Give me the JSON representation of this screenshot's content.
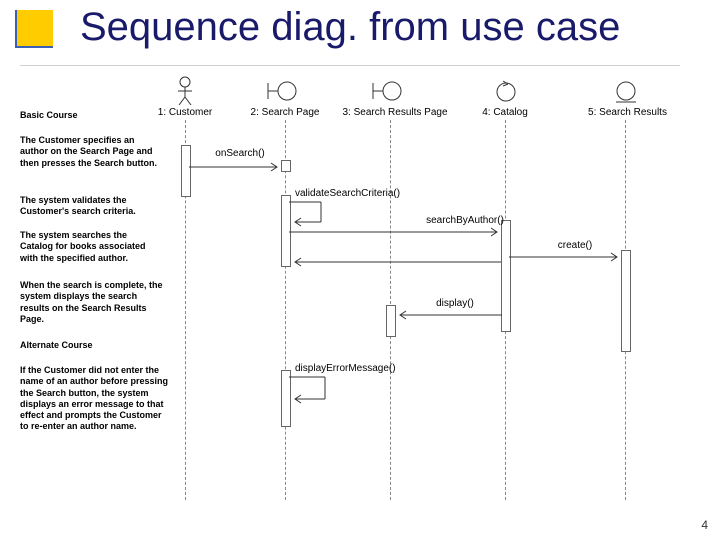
{
  "title": "Sequence diag. from use case",
  "page_number": "4",
  "narration": {
    "basic_course": "Basic Course",
    "n1": "The Customer specifies an author on the Search Page and then presses the Search button.",
    "n2": "The system validates the Customer's search criteria.",
    "n3": "The system searches the Catalog for books associated with the specified author.",
    "n4": "When the search is complete, the system displays the search results on the  Search Results Page.",
    "alternate_course": "Alternate Course",
    "n5": "If the Customer did not enter the name of an author before pressing the Search button, the system displays an error message to that effect and prompts the Customer to re-enter an author name."
  },
  "lifelines": {
    "l1": "1: Customer",
    "l2": "2: Search Page",
    "l3": "3: Search Results Page",
    "l4": "4: Catalog",
    "l5": "5: Search Results"
  },
  "messages": {
    "m1": "onSearch()",
    "m2": "validateSearchCriteria()",
    "m3": "searchByAuthor()",
    "m4": "create()",
    "m5": "display()",
    "m6": "displayErrorMessage()"
  }
}
